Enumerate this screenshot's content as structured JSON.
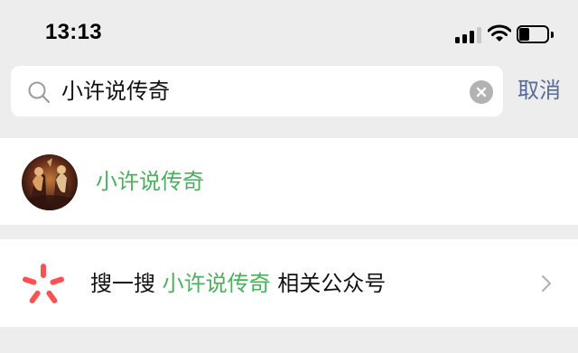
{
  "status_bar": {
    "time": "13:13",
    "battery_level": 0.4,
    "signal_bars_active": 3,
    "signal_bars_total": 4
  },
  "search": {
    "query": "小许说传奇",
    "cancel_label": "取消"
  },
  "result": {
    "name": "小许说传奇"
  },
  "related_search": {
    "prefix": "搜一搜",
    "keyword": "小许说传奇",
    "suffix": "相关公众号"
  },
  "colors": {
    "background": "#ededed",
    "highlight_green": "#4caf5f",
    "link_blue": "#576b95",
    "sousou_red": "#fa5151"
  },
  "icons": {
    "search": "search-icon",
    "clear": "clear-icon",
    "sousou": "sousou-icon",
    "chevron": "chevron-right-icon"
  }
}
